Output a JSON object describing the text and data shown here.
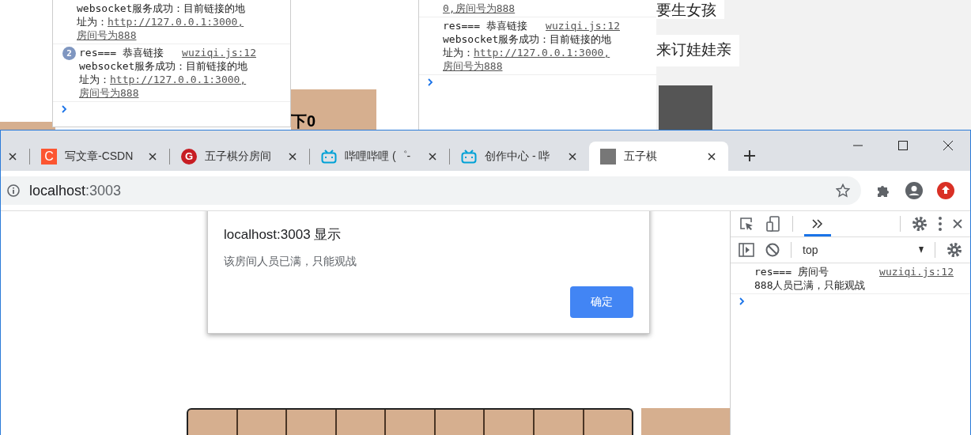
{
  "background": {
    "score_label": "下0",
    "consoles": [
      {
        "entries": [
          {
            "detail": "websocket服务成功：目前链接的地址为：",
            "url": "http://127.0.0.1:3000,房间号为888"
          },
          {
            "count": "2",
            "message": "res=== 恭喜链接",
            "source": "wuziqi.js:12",
            "detail": "websocket服务成功：目前链接的地址为：",
            "url": "http://127.0.0.1:3000,房间号为888"
          }
        ]
      },
      {
        "entries": [
          {
            "url": "0,房间号为888"
          },
          {
            "message": "res=== 恭喜链接",
            "source": "wuziqi.js:12",
            "detail": "websocket服务成功：目前链接的地址为：",
            "url": "http://127.0.0.1:3000,房间号为888"
          }
        ]
      }
    ],
    "chat_messages": [
      "要生女孩",
      "来订娃娃亲"
    ]
  },
  "browser": {
    "tabs": [
      {
        "kind": "partial",
        "selected": false
      },
      {
        "kind": "letter",
        "icon_text": "C",
        "title": "写文章-CSDN",
        "selected": false
      },
      {
        "kind": "badge",
        "icon_text": "G",
        "title": "五子棋分房间",
        "selected": false
      },
      {
        "kind": "tv",
        "title": "哔哩哔哩 (゜-",
        "selected": false
      },
      {
        "kind": "tv",
        "title": "创作中心 - 哔",
        "selected": false
      },
      {
        "kind": "photo",
        "title": "五子棋",
        "selected": true
      }
    ],
    "address": {
      "host": "localhost",
      "port": ":3003"
    },
    "dialog": {
      "title": "localhost:3003 显示",
      "message": "该房间人员已满，只能观战",
      "button": "确定"
    },
    "devtools": {
      "context": "top",
      "entries": [
        {
          "message": "res=== 房间号",
          "source": "wuziqi.js:12",
          "detail": "888人员已满，只能观战"
        }
      ]
    }
  }
}
